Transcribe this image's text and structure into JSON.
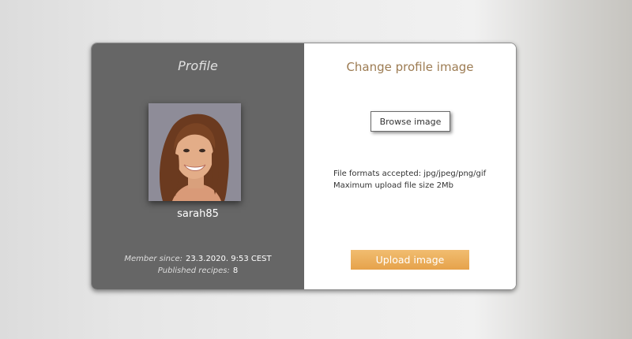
{
  "profile": {
    "title": "Profile",
    "username": "sarah85",
    "member_since_label": "Member since:",
    "member_since_value": "23.3.2020. 9:53 CEST",
    "published_recipes_label": "Published recipes:",
    "published_recipes_value": "8"
  },
  "change_image": {
    "heading": "Change profile image",
    "browse_label": "Browse image",
    "formats_line": "File formats accepted: jpg/jpeg/png/gif",
    "size_line": "Maximum upload file size 2Mb",
    "upload_label": "Upload image"
  },
  "colors": {
    "left_panel": "#666666",
    "heading": "#9c7b52",
    "upload_button": "#e6a24b"
  }
}
